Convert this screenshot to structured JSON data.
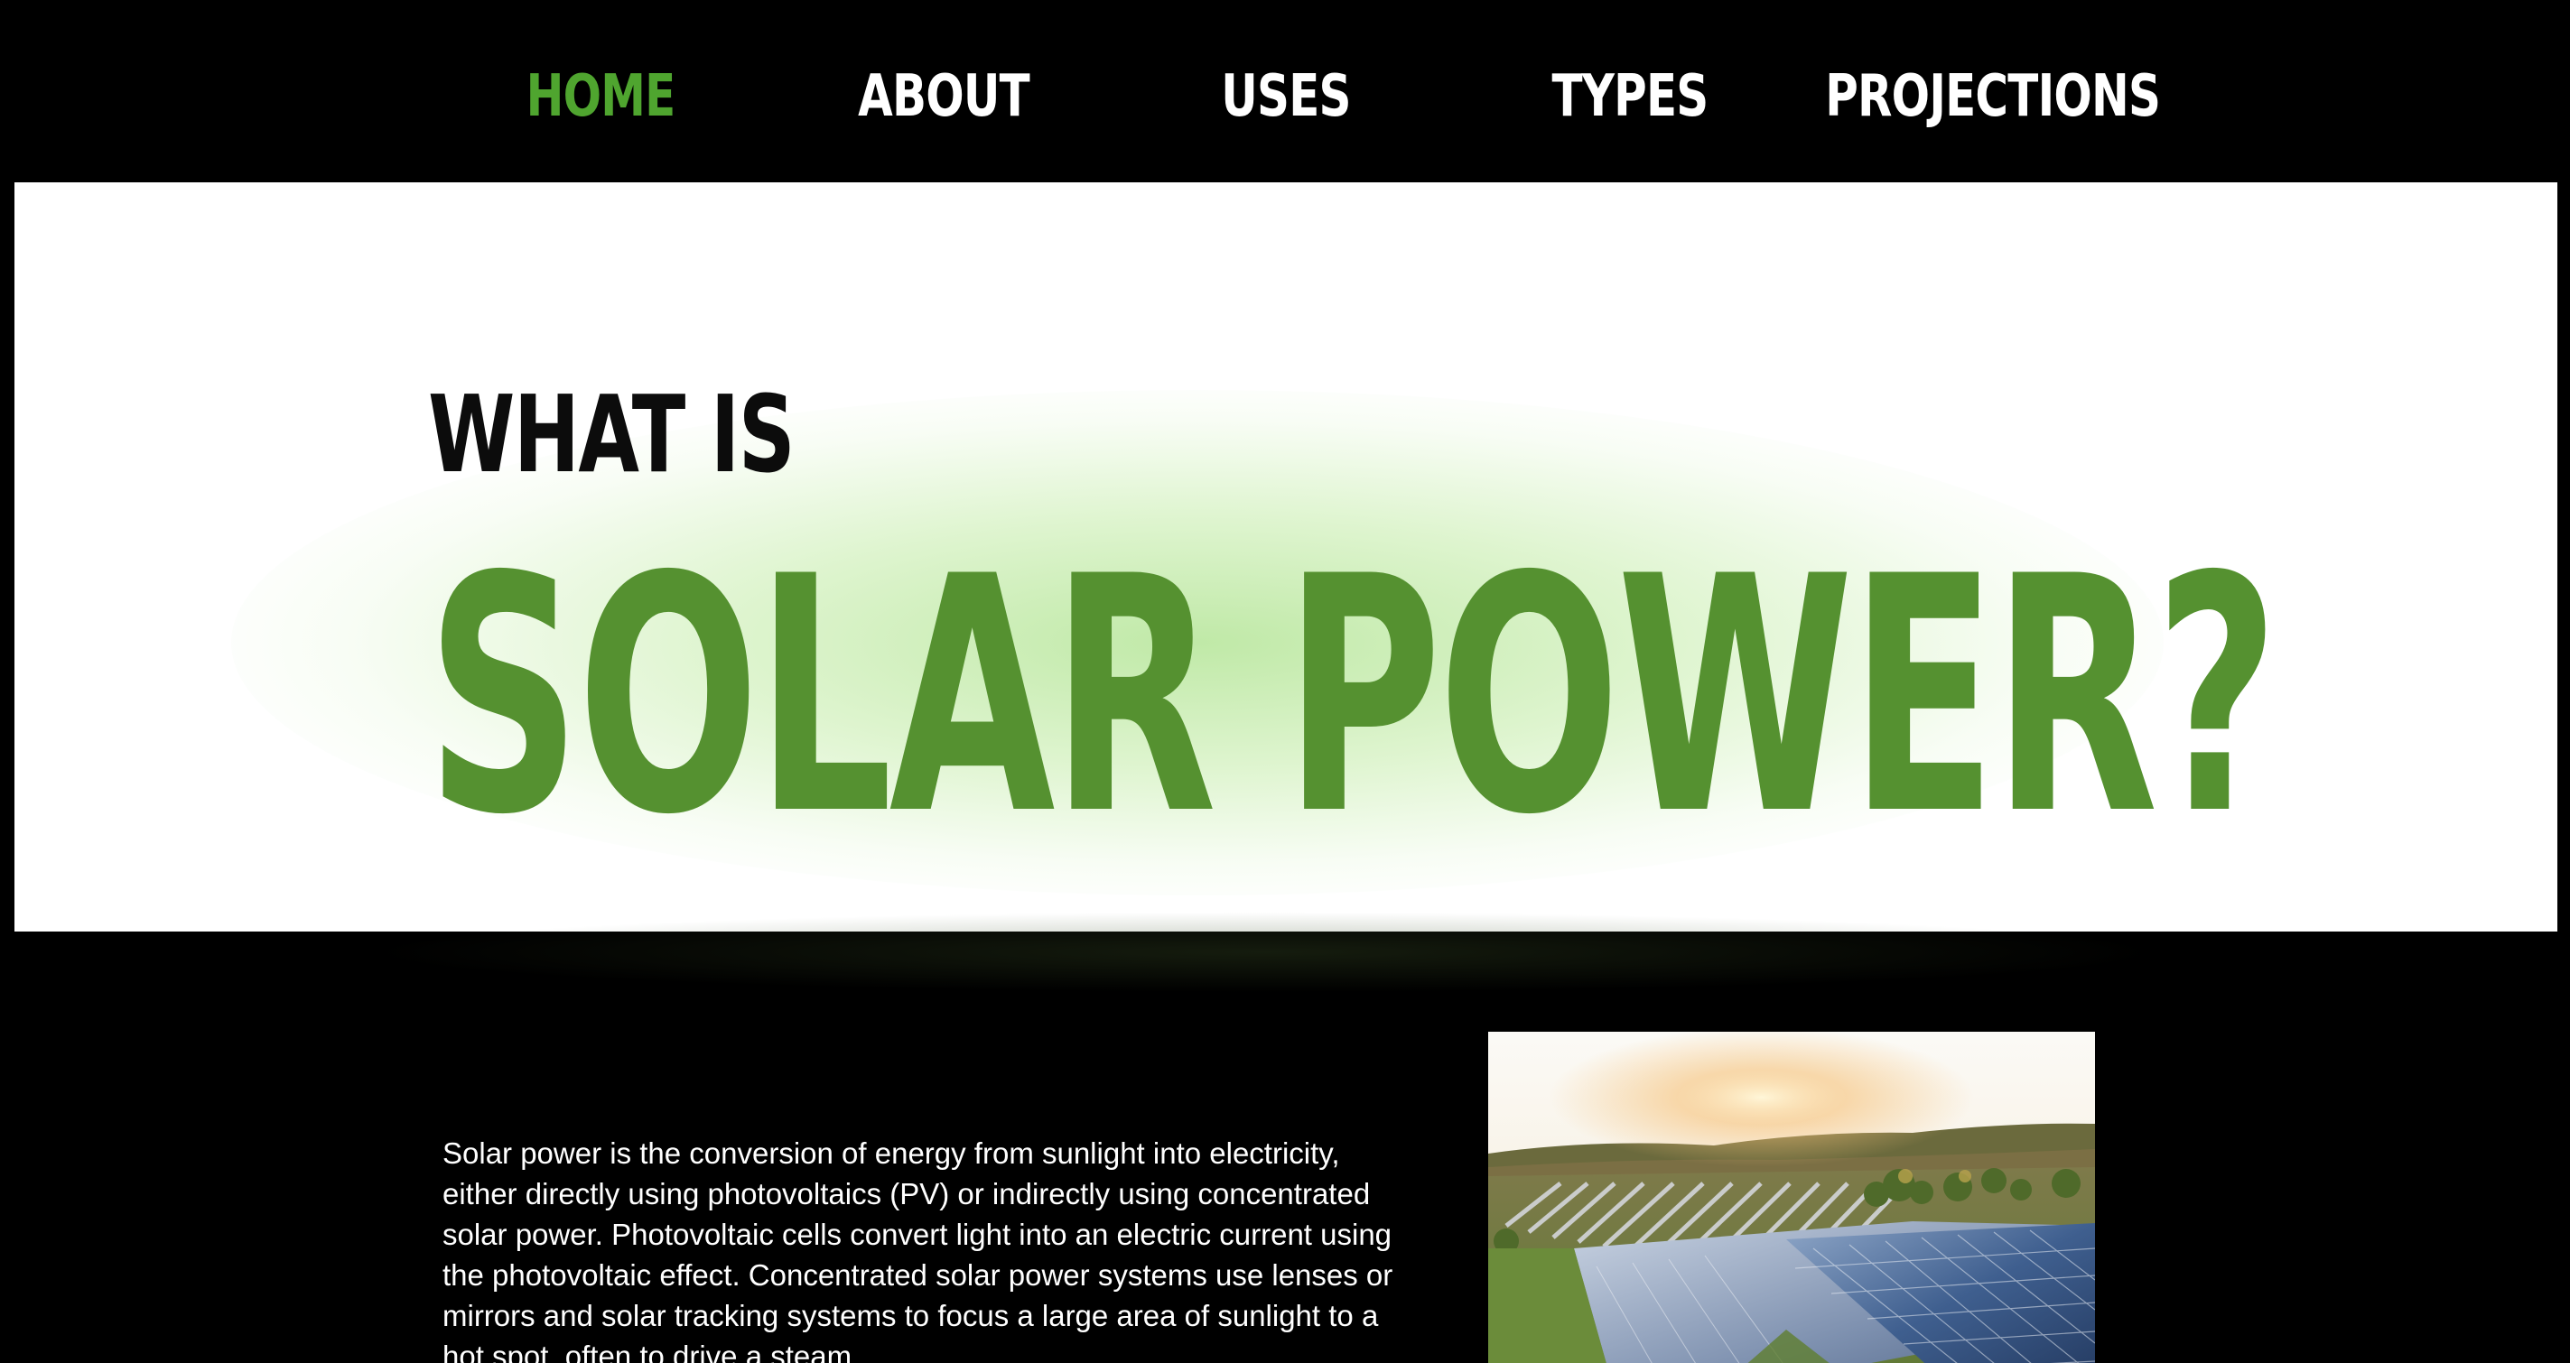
{
  "nav": {
    "items": [
      {
        "label": "HOME",
        "active": true
      },
      {
        "label": "ABOUT",
        "active": false
      },
      {
        "label": "USES",
        "active": false
      },
      {
        "label": "TYPES",
        "active": false
      },
      {
        "label": "PROJECTIONS",
        "active": false
      }
    ]
  },
  "hero": {
    "kicker": "WHAT IS",
    "title": "SOLAR POWER?"
  },
  "intro": {
    "text": "Solar power is the conversion of energy from sunlight into electricity, either directly using photovoltaics (PV) or indirectly using concentrated solar power. Photovoltaic cells convert light into an electric current using the photovoltaic effect. Concentrated solar power systems use lenses or mirrors and solar tracking systems to focus a large area of sunlight to a hot spot, often to drive a steam"
  },
  "photo": {
    "subject": "solar-farm-photo"
  },
  "colors": {
    "background": "#000000",
    "accent_green": "#4fa52f",
    "title_green": "#559130",
    "hero_background": "#ffffff",
    "nav_text": "#ffffff"
  }
}
